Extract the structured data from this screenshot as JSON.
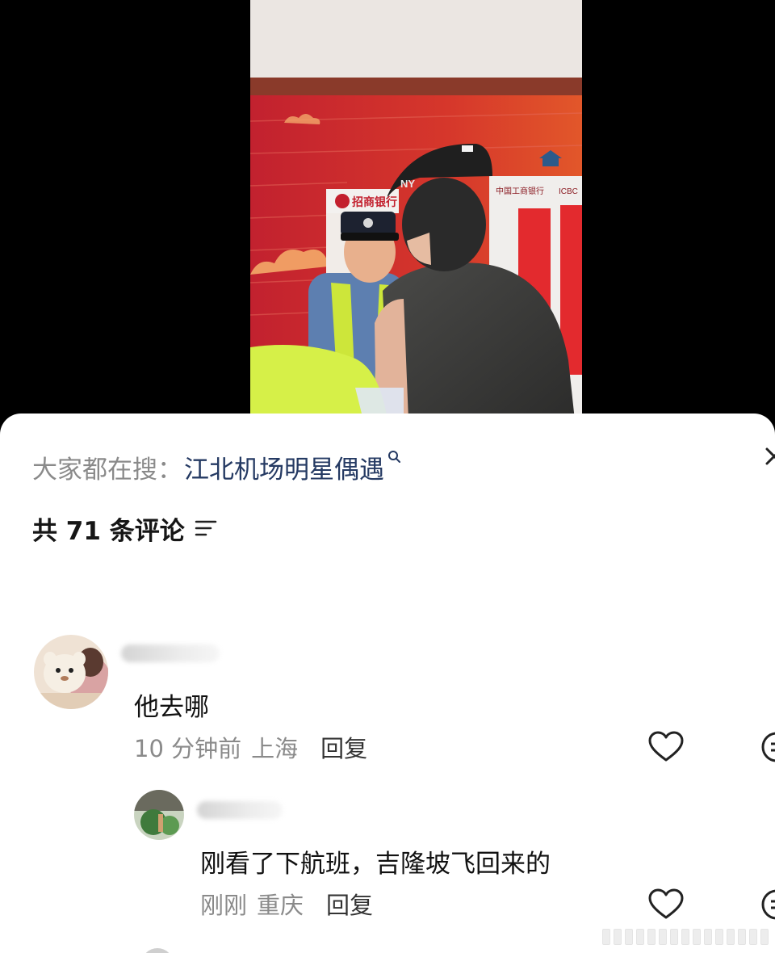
{
  "hot_search": {
    "prefix": "大家都在搜：",
    "term": "江北机场明星偶遇"
  },
  "comments_header": {
    "count_text": "共 71 条评论"
  },
  "comments": [
    {
      "text": "他去哪",
      "time": "10 分钟前",
      "location": "上海",
      "reply_label": "回复"
    },
    {
      "text": "刚看了下航班，吉隆坡飞回来的",
      "time": "刚刚",
      "location": "重庆",
      "reply_label": "回复"
    }
  ],
  "video": {
    "signage": [
      {
        "label": "招商银行"
      },
      {
        "label": "中国工商银行"
      },
      {
        "label": "ICBC"
      }
    ],
    "cap_logo": "NY"
  },
  "colors": {
    "hot_term": "#253a63",
    "muted_text": "#8a8a8a",
    "sheet_bg": "#ffffff",
    "page_bg": "#000000"
  }
}
